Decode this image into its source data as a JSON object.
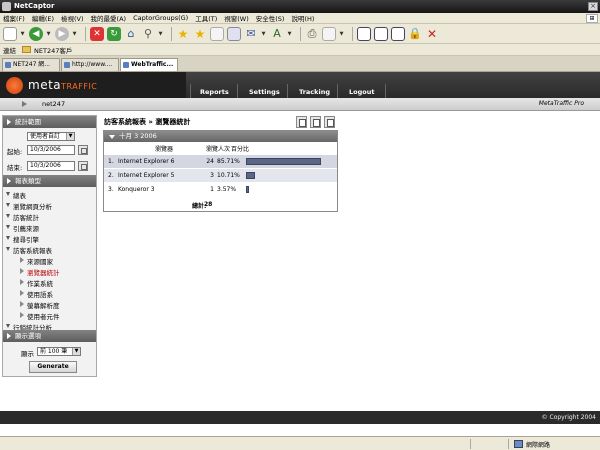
{
  "window": {
    "title": "NetCaptor"
  },
  "menu": [
    "檔案(F)",
    "編輯(E)",
    "檢視(V)",
    "我的最愛(A)",
    "CaptorGroups(G)",
    "工具(T)",
    "視窗(W)",
    "安全性(S)",
    "說明(H)"
  ],
  "links_bar": {
    "label": "連結",
    "item": "NET247客戶"
  },
  "tabs": [
    {
      "label": "NET247 網..."
    },
    {
      "label": "http://www...."
    },
    {
      "label": "WebTraffic..."
    }
  ],
  "app": {
    "logo_prefix": "meta",
    "logo_suffix": "TRAFFIC",
    "nav": [
      "Reports",
      "Settings",
      "Tracking",
      "Logout"
    ],
    "user": "net247",
    "product": "MetaTraffic Pro"
  },
  "sidebar": {
    "date_range_header": "統計範圍",
    "period_value": "使用者自訂",
    "start_label": "起始:",
    "start_value": "10/3/2006",
    "end_label": "結束:",
    "end_value": "10/3/2006",
    "report_type_header": "報表類型",
    "tree": [
      "總表",
      "瀏覽網頁分析",
      "訪客統計",
      "引薦來源",
      "搜尋引擎",
      "訪客系統報表"
    ],
    "sub_tree": [
      "來源國家",
      "瀏覽器統計",
      "作業系統",
      "使用語系",
      "螢幕解析度",
      "使用者元件"
    ],
    "tree_after": "行銷統計分析",
    "display_header": "顯示選項",
    "show_label": "顯示",
    "show_value": "前 100 筆",
    "generate_label": "Generate"
  },
  "report": {
    "breadcrumb": "訪客系統報表 » 瀏覽器統計",
    "date_header": "十月 3 2006",
    "columns": {
      "browser": "瀏覽器",
      "visitors": "瀏覽人次",
      "percent": "百分比"
    },
    "rows": [
      {
        "rank": "1.",
        "browser": "Internet Explorer 6",
        "visitors": "24",
        "percent": "85.71%",
        "pct": 85.71
      },
      {
        "rank": "2.",
        "browser": "Internet Explorer 5",
        "visitors": "3",
        "percent": "10.71%",
        "pct": 10.71
      },
      {
        "rank": "3.",
        "browser": "Konqueror 3",
        "visitors": "1",
        "percent": "3.57%",
        "pct": 3.57
      }
    ],
    "total_label": "總計:",
    "total_value": "28"
  },
  "footer": {
    "copyright": "© Copyright 2004"
  },
  "status": {
    "zone": "網際網路"
  },
  "colors": {
    "accent": "#ff6a1a",
    "bar": "#596784",
    "header_dark": "#2b2b2b"
  }
}
